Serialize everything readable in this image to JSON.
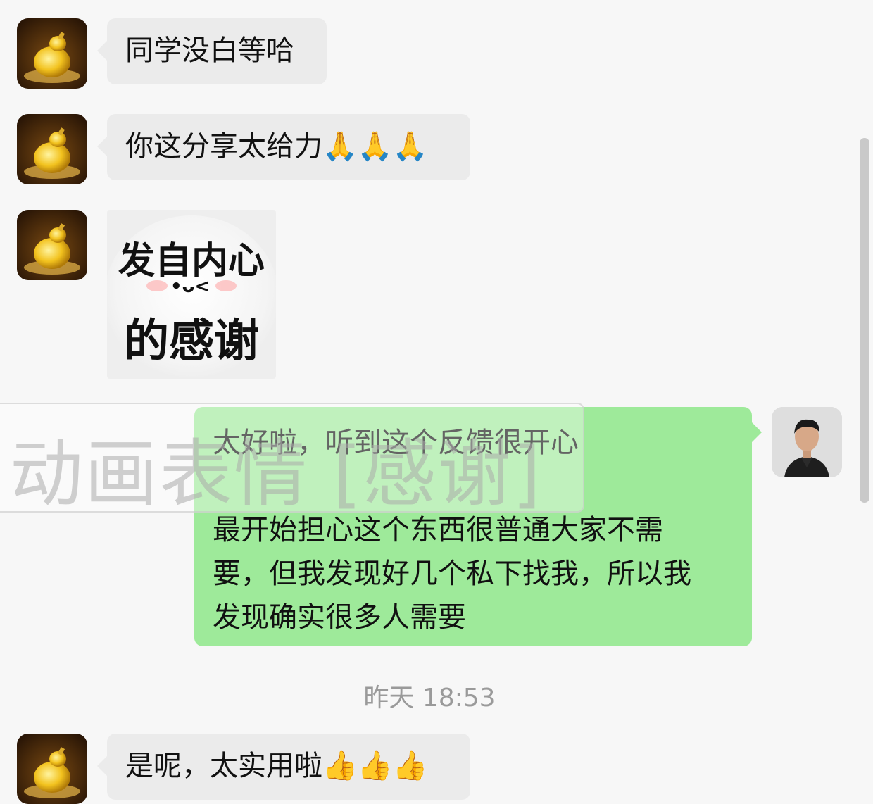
{
  "messages": [
    {
      "text": "同学没白等哈"
    },
    {
      "text": "你这分享太给力🙏🙏🙏"
    },
    {
      "sticker_line1": "发自内心",
      "sticker_face": "•ᴗ<",
      "sticker_line2": "的感谢"
    },
    {
      "text": "太好啦，听到这个反馈很开心\n\n最开始担心这个东西很普通大家不需\n要，但我发现好几个私下找我，所以我\n发现确实很多人需要"
    },
    {
      "text": "是呢，太实用啦👍👍👍"
    }
  ],
  "sticker_overlay": "动画表情 [感谢]",
  "timestamp": "昨天 18:53",
  "colors": {
    "incoming_bubble": "#ebebeb",
    "outgoing_bubble": "#9eea9a",
    "background": "#f7f7f7"
  },
  "icons": {
    "contact_avatar": "golden-gourd-avatar-icon",
    "self_avatar": "man-portrait-avatar-icon"
  }
}
